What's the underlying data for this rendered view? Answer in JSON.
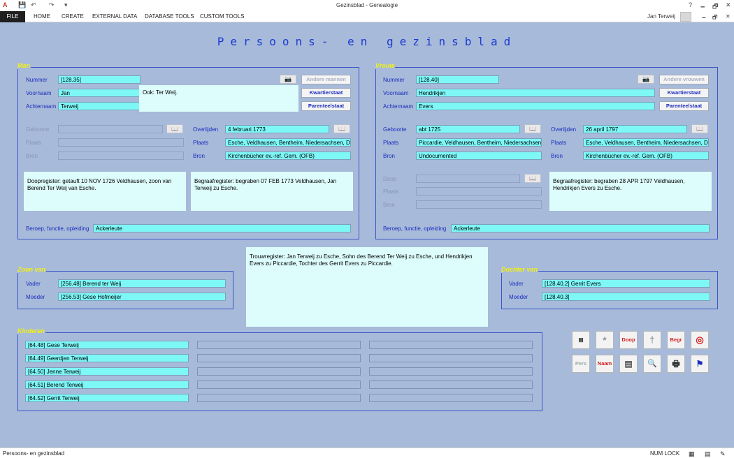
{
  "app": {
    "title": "Gezinsblad - Genealogie",
    "help": "?",
    "user": "Jan Terweij",
    "minimize": "🗕",
    "restore": "🗗",
    "close": "✕"
  },
  "ribbon": {
    "file": "FILE",
    "tabs": [
      "HOME",
      "CREATE",
      "EXTERNAL DATA",
      "DATABASE TOOLS",
      "CUSTOM TOOLS"
    ]
  },
  "form": {
    "title": "Persoons- en gezinsblad"
  },
  "man": {
    "section_label": "Man",
    "nummer_label": "Nummer",
    "nummer": "[128.35]",
    "voornaam_label": "Voornaam",
    "voornaam": "Jan",
    "achternaam_label": "Achternaam",
    "achternaam": "Terweij",
    "ook_text": "Ook: Ter Weij.",
    "andere_btn": "Andere mannen",
    "kwartier_btn": "Kwartierstaat",
    "parenteel_btn": "Parenteelstaat",
    "geboorte_label": "Geboorte",
    "geboorte": "",
    "plaats_label": "Plaats",
    "geb_plaats": "",
    "bron_label": "Bron",
    "geb_bron": "",
    "overlijden_label": "Overlijden",
    "overlijden": "4 februari 1773",
    "ovl_plaats_label": "Plaats",
    "ovl_plaats": "Esche, Veldhausen, Bentheim, Niedersachsen, De",
    "ovl_bron_label": "Bron",
    "ovl_bron": "Kirchenbücher ev.-ref. Gem. (OFB)",
    "doop_memo": "Doopregister: getauft 10 NOV 1726 Veldhausen, zoon van Berend Ter Weij van Esche.",
    "begraaf_memo": "Begraafregister: begraben 07 FEB 1773 Veldhausen, Jan Terweij zu Esche.",
    "beroep_label": "Beroep, functie, opleiding",
    "beroep": "Ackerleute"
  },
  "vrouw": {
    "section_label": "Vrouw",
    "nummer_label": "Nummer",
    "nummer": "[128.40]",
    "voornaam_label": "Voornaam",
    "voornaam": "Hendrikjen",
    "achternaam_label": "Achternaam",
    "achternaam": "Evers",
    "andere_btn": "Andere vrouwen",
    "kwartier_btn": "Kwartierstaat",
    "parenteel_btn": "Parenteelstaat",
    "geboorte_label": "Geboorte",
    "geboorte": "abt 1725",
    "plaats_label": "Plaats",
    "geb_plaats": "Piccardie, Veldhausen, Bentheim, Niedersachsen,",
    "bron_label": "Bron",
    "geb_bron": "Undocumented",
    "overlijden_label": "Overlijden",
    "overlijden": "26 april 1797",
    "ovl_plaats_label": "Plaats",
    "ovl_plaats": "Esche, Veldhausen, Bentheim, Niedersachsen, De",
    "ovl_bron_label": "Bron",
    "ovl_bron": "Kirchenbücher ev.-ref. Gem. (OFB)",
    "doop_label": "Doop",
    "doop": "",
    "doop_plaats_label": "Plaats",
    "doop_plaats": "",
    "doop_bron_label": "Bron",
    "doop_bron": "",
    "begraaf_memo": "Begraafregister: begraben 28 APR 1797 Veldhausen, Hendrikjen Evers zu Esche.",
    "beroep_label": "Beroep, functie, opleiding",
    "beroep": "Ackerleute"
  },
  "trouw": {
    "memo": "Trouwregister: Jan Terweij zu Esche, Sohn des Berend Ter Weij zu Esche, und Hendrikjen Evers zu Piccardie, Tochter des Gerrit Evers zu Piccardie."
  },
  "zoon_van": {
    "section_label": "Zoon van",
    "vader_label": "Vader",
    "vader": "[256.48] Berend ter Weij",
    "moeder_label": "Moeder",
    "moeder": "[256.53] Gese Hofmeijer"
  },
  "dochter_van": {
    "section_label": "Dochter van",
    "vader_label": "Vader",
    "vader": "[128.40.2] Gerrit Evers",
    "moeder_label": "Moeder",
    "moeder": "[128.40.3]"
  },
  "kinderen": {
    "section_label": "Kinderen",
    "col1": [
      "[64.48] Gese Terweij",
      "[64.49] Geerdjen Terweij",
      "[64.50] Jenne Terweij",
      "[64.51] Berend Terweij",
      "[64.52] Gerrit Terweij"
    ]
  },
  "tools": {
    "row1": [
      {
        "label": "",
        "icon": "document-icon"
      },
      {
        "label": "*",
        "icon": "asterisk-icon"
      },
      {
        "label": "Doop",
        "icon": "doop-icon"
      },
      {
        "label": "†",
        "icon": "cross-icon"
      },
      {
        "label": "Begr",
        "icon": "begr-icon"
      },
      {
        "label": "◎",
        "icon": "rings-icon"
      }
    ],
    "row2": [
      {
        "label": "Pers",
        "icon": "pers-icon"
      },
      {
        "label": "Naam",
        "icon": "naam-icon"
      },
      {
        "label": "▤",
        "icon": "card-icon"
      },
      {
        "label": "🔍",
        "icon": "preview-icon"
      },
      {
        "label": "🖶",
        "icon": "print-icon"
      },
      {
        "label": "⚑",
        "icon": "flag-icon"
      }
    ]
  },
  "status": {
    "left": "Persoons- en gezinsblad",
    "numlock": "NUM LOCK"
  },
  "colors": {
    "background": "#a7bad9",
    "field": "#7ef7f7",
    "memo": "#ddfcfc",
    "label": "#1c2dbd",
    "section": "#f5f20f",
    "title": "#1c3bd1"
  }
}
